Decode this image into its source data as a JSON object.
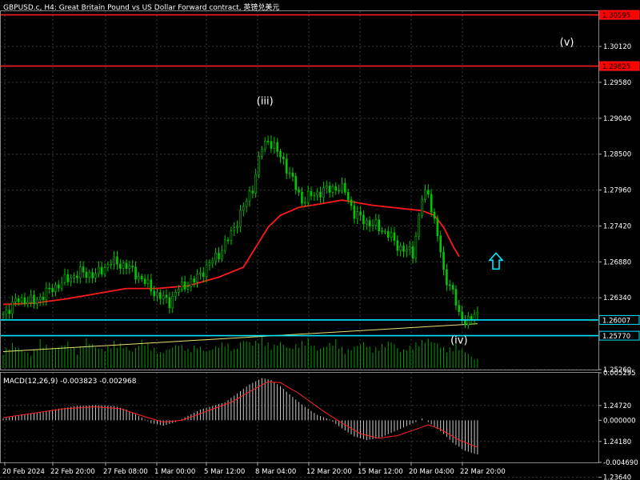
{
  "header": {
    "title": "GBPUSD.c, H4:  Great Britain Pound vs US Dollar Forward contract, 英镑兑美元"
  },
  "colors": {
    "background": "#000000",
    "grid": "#3a3a3a",
    "candle": "#00c800",
    "ma": "#ff1a1a",
    "cyan": "#00e5ff",
    "trend": "#e8e070",
    "volume": "#00a000",
    "macd_hist": "#c8c8c8",
    "macd_signal": "#ff2020",
    "tag_red": "#ff0000",
    "tag_cyan": "#00e5ff"
  },
  "chart_data": [
    {
      "type": "candlestick",
      "title": "GBPUSD.c, H4:  Great Britain Pound vs US Dollar Forward contract, 英镑兑美元",
      "ylim": [
        1.2526,
        1.3065
      ],
      "y_ticks": [
        "1.30120",
        "1.29580",
        "1.29040",
        "1.28500",
        "1.27960",
        "1.27420",
        "1.26880",
        "1.26340",
        "1.25260",
        "1.24720",
        "1.24180",
        "1.23640"
      ],
      "x_ticks": [
        "20 Feb 2024",
        "22 Feb 20:00",
        "27 Feb 08:00",
        "1 Mar 00:00",
        "5 Mar 12:00",
        "8 Mar 04:00",
        "12 Mar 20:00",
        "15 Mar 12:00",
        "20 Mar 04:00",
        "22 Mar 20:00"
      ],
      "close_path": [
        [
          0,
          1.261
        ],
        [
          5,
          1.2632
        ],
        [
          10,
          1.2628
        ],
        [
          15,
          1.2645
        ],
        [
          20,
          1.266
        ],
        [
          25,
          1.2672
        ],
        [
          30,
          1.2668
        ],
        [
          35,
          1.2688
        ],
        [
          40,
          1.2682
        ],
        [
          45,
          1.2662
        ],
        [
          50,
          1.2638
        ],
        [
          54,
          1.2628
        ],
        [
          57,
          1.2648
        ],
        [
          62,
          1.266
        ],
        [
          66,
          1.268
        ],
        [
          70,
          1.27
        ],
        [
          74,
          1.273
        ],
        [
          78,
          1.277
        ],
        [
          81,
          1.28
        ],
        [
          84,
          1.286
        ],
        [
          86,
          1.2872
        ],
        [
          88,
          1.286
        ],
        [
          91,
          1.284
        ],
        [
          94,
          1.281
        ],
        [
          97,
          1.278
        ],
        [
          100,
          1.2788
        ],
        [
          104,
          1.2795
        ],
        [
          108,
          1.28
        ],
        [
          111,
          1.2795
        ],
        [
          114,
          1.276
        ],
        [
          118,
          1.2748
        ],
        [
          121,
          1.2742
        ],
        [
          125,
          1.273
        ],
        [
          128,
          1.2712
        ],
        [
          131,
          1.2705
        ],
        [
          133,
          1.27
        ],
        [
          136,
          1.2785
        ],
        [
          138,
          1.279
        ],
        [
          141,
          1.273
        ],
        [
          143,
          1.267
        ],
        [
          146,
          1.2645
        ],
        [
          148,
          1.2605
        ],
        [
          150,
          1.26
        ],
        [
          152,
          1.2603
        ],
        [
          154,
          1.2608
        ]
      ],
      "ma_path": [
        [
          0,
          1.2624
        ],
        [
          10,
          1.2626
        ],
        [
          20,
          1.2632
        ],
        [
          30,
          1.264
        ],
        [
          40,
          1.2648
        ],
        [
          50,
          1.2648
        ],
        [
          60,
          1.2652
        ],
        [
          70,
          1.2665
        ],
        [
          78,
          1.268
        ],
        [
          82,
          1.271
        ],
        [
          86,
          1.274
        ],
        [
          90,
          1.2758
        ],
        [
          96,
          1.277
        ],
        [
          104,
          1.2776
        ],
        [
          110,
          1.2781
        ],
        [
          120,
          1.2773
        ],
        [
          130,
          1.2768
        ],
        [
          136,
          1.2765
        ],
        [
          140,
          1.2758
        ],
        [
          143,
          1.274
        ],
        [
          146,
          1.2712
        ],
        [
          148,
          1.2696
        ]
      ],
      "trendline": [
        [
          0,
          1.2553
        ],
        [
          154,
          1.2595
        ]
      ],
      "levels": [
        {
          "name": "resistance-upper",
          "value": 1.30595,
          "label": "1.30595",
          "color": "#ff1a1a"
        },
        {
          "name": "resistance-lower",
          "value": 1.29825,
          "label": "1.29825",
          "color": "#ff1a1a"
        },
        {
          "name": "bid",
          "value": 1.26007,
          "label": "1.26007",
          "color": "#00e5ff"
        },
        {
          "name": "support",
          "value": 1.2577,
          "label": "1.25770",
          "color": "#00e5ff"
        }
      ],
      "annotations": [
        {
          "text": "(iii)",
          "x": 85,
          "y": 1.2925
        },
        {
          "text": "(iv)",
          "x": 148,
          "y": 1.2565
        },
        {
          "text": "(v)",
          "x": 183,
          "y": 1.3013
        }
      ],
      "arrow": {
        "x": 160,
        "y": 1.2688,
        "direction": "up"
      },
      "volume": [
        [
          0,
          0.55
        ],
        [
          3,
          0.8
        ],
        [
          6,
          0.6
        ],
        [
          9,
          0.45
        ],
        [
          12,
          0.9
        ],
        [
          15,
          0.65
        ],
        [
          18,
          0.7
        ],
        [
          21,
          0.85
        ],
        [
          24,
          0.55
        ],
        [
          27,
          0.95
        ],
        [
          30,
          0.7
        ],
        [
          33,
          0.6
        ],
        [
          36,
          0.85
        ],
        [
          39,
          0.75
        ],
        [
          42,
          0.55
        ],
        [
          45,
          0.9
        ],
        [
          48,
          0.7
        ],
        [
          51,
          0.5
        ],
        [
          54,
          0.65
        ],
        [
          57,
          0.8
        ],
        [
          60,
          0.6
        ],
        [
          63,
          0.75
        ],
        [
          66,
          0.55
        ],
        [
          69,
          0.7
        ],
        [
          72,
          0.85
        ],
        [
          75,
          0.6
        ],
        [
          78,
          0.95
        ],
        [
          81,
          0.8
        ],
        [
          84,
          1.0
        ],
        [
          87,
          0.7
        ],
        [
          90,
          0.85
        ],
        [
          93,
          0.65
        ],
        [
          96,
          0.8
        ],
        [
          99,
          0.95
        ],
        [
          102,
          0.6
        ],
        [
          105,
          0.75
        ],
        [
          108,
          0.9
        ],
        [
          111,
          0.55
        ],
        [
          114,
          0.7
        ],
        [
          117,
          0.85
        ],
        [
          120,
          0.6
        ],
        [
          123,
          0.75
        ],
        [
          126,
          0.9
        ],
        [
          129,
          0.55
        ],
        [
          132,
          0.7
        ],
        [
          135,
          0.85
        ],
        [
          138,
          0.95
        ],
        [
          141,
          0.8
        ],
        [
          144,
          0.6
        ],
        [
          147,
          0.75
        ],
        [
          150,
          0.55
        ],
        [
          153,
          0.3
        ]
      ]
    },
    {
      "type": "macd",
      "title": "MACD(12,26,9) -0.003823 -0.002968",
      "ylim": [
        -0.00469,
        0.005295
      ],
      "y_ticks": [
        "0.005295",
        "0.000000",
        "-0.004690"
      ],
      "histogram": [
        [
          0,
          0.0002
        ],
        [
          6,
          0.0006
        ],
        [
          12,
          0.0009
        ],
        [
          18,
          0.0013
        ],
        [
          24,
          0.0016
        ],
        [
          30,
          0.0017
        ],
        [
          36,
          0.0016
        ],
        [
          40,
          0.0012
        ],
        [
          44,
          0.0005
        ],
        [
          48,
          -0.0003
        ],
        [
          52,
          -0.0006
        ],
        [
          56,
          -0.0002
        ],
        [
          60,
          0.0005
        ],
        [
          64,
          0.0012
        ],
        [
          68,
          0.0016
        ],
        [
          72,
          0.002
        ],
        [
          76,
          0.003
        ],
        [
          80,
          0.004
        ],
        [
          84,
          0.0047
        ],
        [
          87,
          0.0045
        ],
        [
          90,
          0.0038
        ],
        [
          94,
          0.0026
        ],
        [
          98,
          0.0015
        ],
        [
          102,
          0.0006
        ],
        [
          106,
          0.0001
        ],
        [
          110,
          -0.0009
        ],
        [
          114,
          -0.0018
        ],
        [
          118,
          -0.0022
        ],
        [
          122,
          -0.002
        ],
        [
          126,
          -0.0014
        ],
        [
          130,
          -0.0008
        ],
        [
          134,
          -0.0002
        ],
        [
          136,
          0.0002
        ],
        [
          138,
          -0.0002
        ],
        [
          142,
          -0.0012
        ],
        [
          146,
          -0.0025
        ],
        [
          150,
          -0.0034
        ],
        [
          154,
          -0.0038
        ]
      ],
      "signal": [
        [
          0,
          0.0003
        ],
        [
          10,
          0.0008
        ],
        [
          20,
          0.0013
        ],
        [
          30,
          0.0015
        ],
        [
          38,
          0.0013
        ],
        [
          46,
          0.0004
        ],
        [
          52,
          -0.0002
        ],
        [
          58,
          0.0
        ],
        [
          66,
          0.001
        ],
        [
          74,
          0.002
        ],
        [
          80,
          0.0032
        ],
        [
          86,
          0.0043
        ],
        [
          90,
          0.0042
        ],
        [
          96,
          0.003
        ],
        [
          104,
          0.001
        ],
        [
          110,
          -0.0003
        ],
        [
          116,
          -0.0015
        ],
        [
          122,
          -0.002
        ],
        [
          128,
          -0.0017
        ],
        [
          134,
          -0.001
        ],
        [
          138,
          -0.0005
        ],
        [
          142,
          -0.001
        ],
        [
          148,
          -0.0022
        ],
        [
          154,
          -0.003
        ]
      ]
    }
  ]
}
